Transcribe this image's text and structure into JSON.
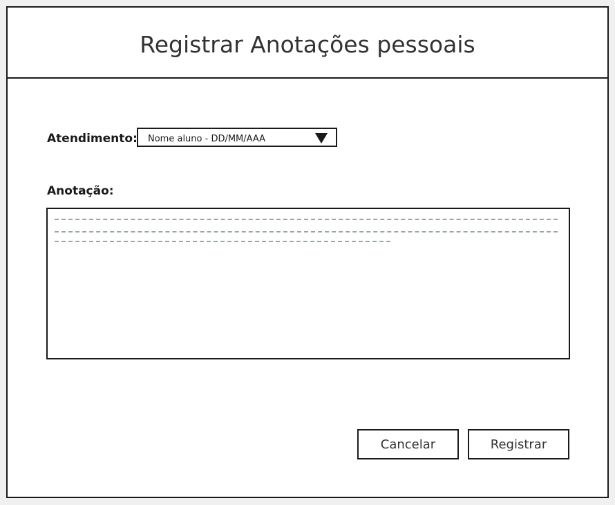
{
  "header": {
    "title": "Registrar Anotações pessoais"
  },
  "form": {
    "atendimento": {
      "label": "Atendimento:",
      "selected_value": "Nome aluno - DD/MM/AAA"
    },
    "anotacao": {
      "label": "Anotação:"
    }
  },
  "actions": {
    "cancel_label": "Cancelar",
    "register_label": "Registrar"
  },
  "colors": {
    "border": "#1a1a1a",
    "placeholder_lines": "#9aa4ad",
    "background": "#ffffff"
  }
}
